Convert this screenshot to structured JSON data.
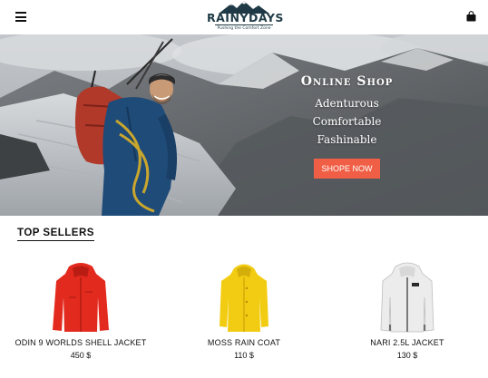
{
  "header": {
    "menu_icon": "hamburger-menu-icon",
    "logo_name": "RAINYDAYS",
    "logo_tagline": "Pushing the Comfort Zone",
    "cart_icon": "shopping-bag-icon"
  },
  "hero": {
    "title": "Online Shop",
    "lines": [
      "Adenturous",
      "Comfortable",
      "Fashinable"
    ],
    "button_label": "SHOPE NOW",
    "button_color": "#f05f45"
  },
  "top_sellers": {
    "title": "TOP SELLERS",
    "products": [
      {
        "name": "ODIN 9 WORLDS SHELL JACKET",
        "price": "450 $",
        "color": "#e32a1e"
      },
      {
        "name": "MOSS RAIN COAT",
        "price": "110 $",
        "color": "#f2cc12"
      },
      {
        "name": "NARI 2.5L JACKET",
        "price": "130 $",
        "color": "#ececec"
      }
    ]
  }
}
